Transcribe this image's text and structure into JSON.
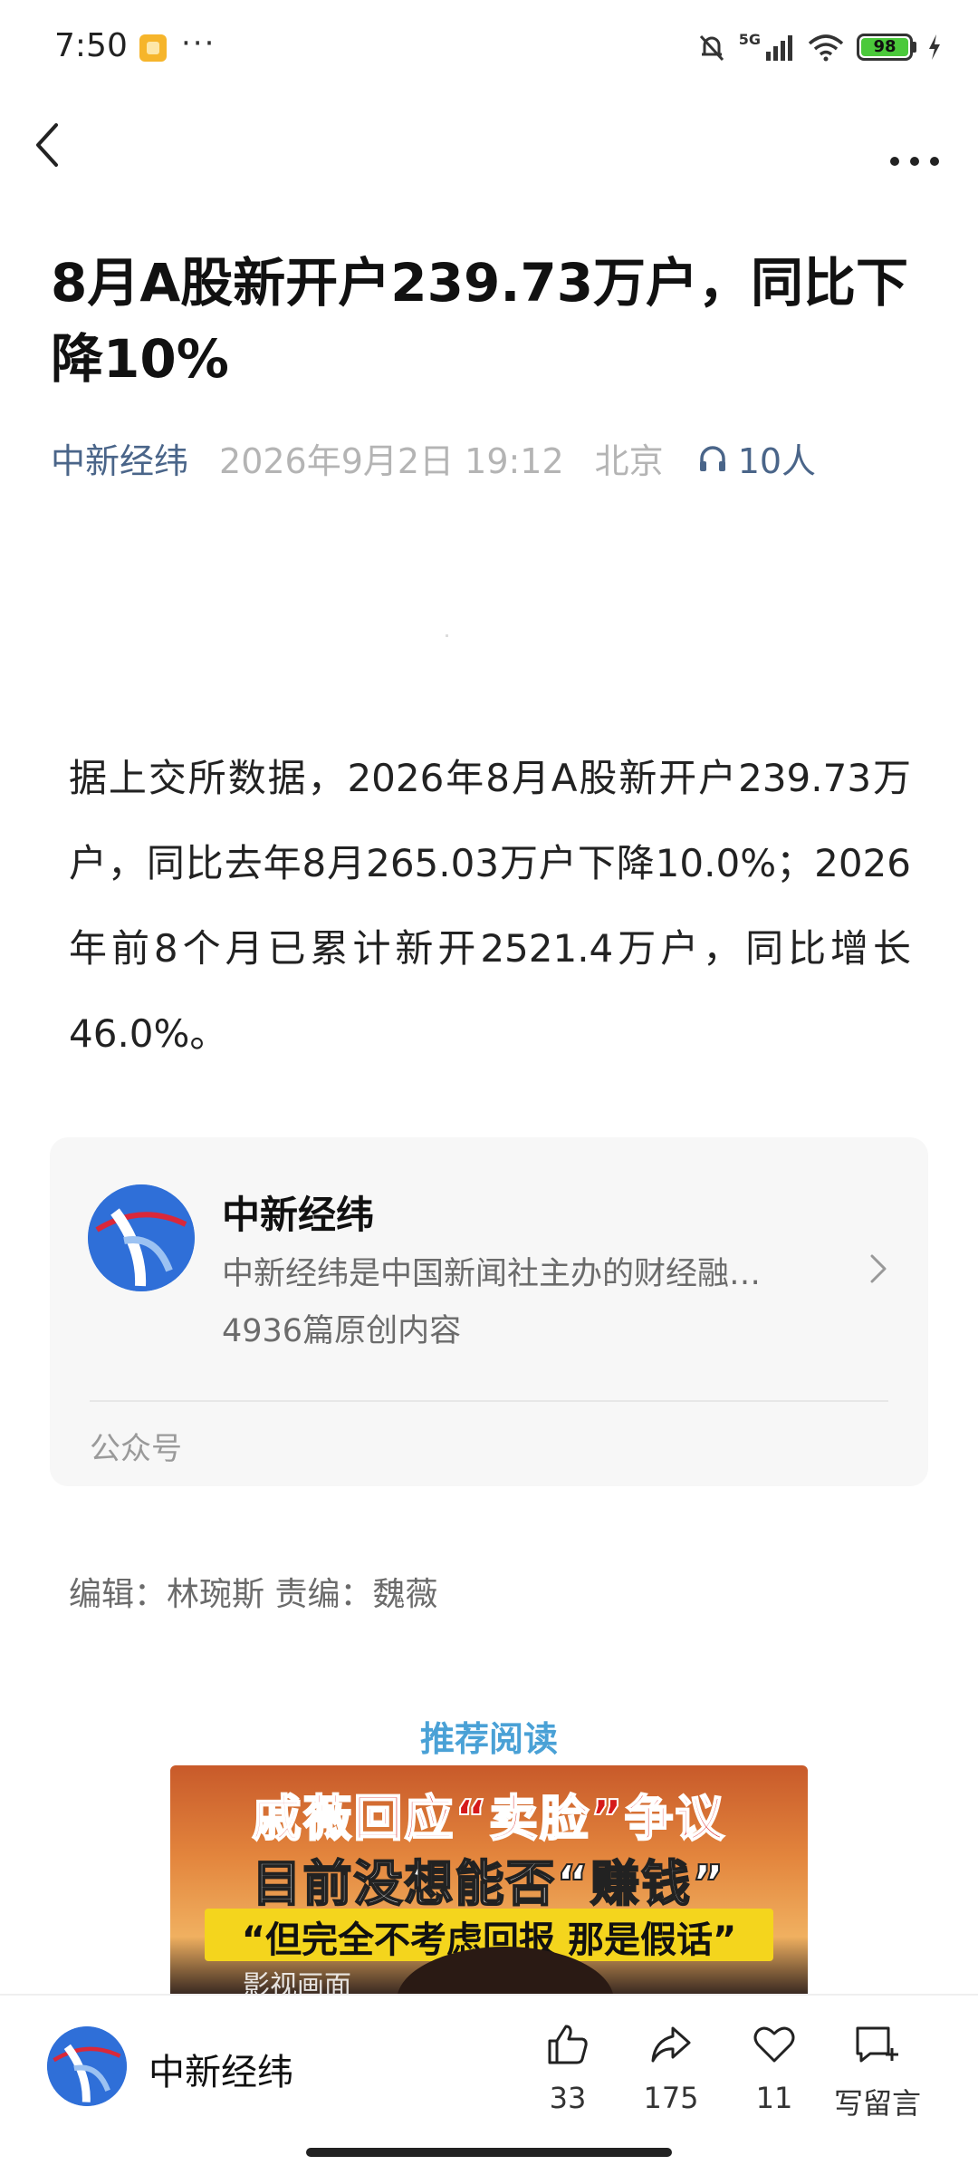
{
  "status_bar": {
    "time": "7:50",
    "dots": "···",
    "network": "5G",
    "battery": "98"
  },
  "article": {
    "title": "8月A股新开户239.73万户，同比下降10%",
    "source": "中新经纬",
    "date": "2026年9月2日 19:12",
    "location": "北京",
    "listeners": "10人",
    "body": "据上交所数据，2026年8月A股新开户239.73万户，同比去年8月265.03万户下降10.0%；2026年前8个月已累计新开2521.4万户，同比增长46.0%。"
  },
  "account_card": {
    "name": "中新经纬",
    "description": "中新经纬是中国新闻社主办的财经融…",
    "original_count": "4936篇原创内容",
    "type_label": "公众号"
  },
  "editor_line": "编辑：林琬斯 责编：魏薇",
  "recommend": {
    "label": "推荐阅读",
    "thumb_line1": "戚薇回应“卖脸”争议",
    "thumb_line2": "目前没想能否“赚钱”",
    "thumb_line3": "“但完全不考虑回报 那是假话”",
    "thumb_tag": "影视画面"
  },
  "bottom_bar": {
    "account_name": "中新经纬",
    "like_count": "33",
    "share_count": "175",
    "favorite_count": "11",
    "comment_label": "写留言"
  },
  "colors": {
    "link_blue": "#4a6589",
    "recommend_blue": "#4aa1d6",
    "brand_blue": "#2f6fd8",
    "battery_green": "#4bc93b"
  }
}
